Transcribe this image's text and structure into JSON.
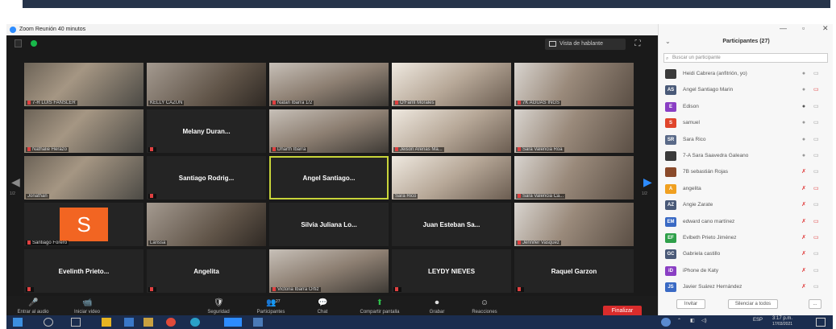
{
  "window": {
    "title": "Zoom Reunión 40 minutos"
  },
  "header": {
    "view_label": "Vista de hablante",
    "fullscreen_icon": "fullscreen-icon"
  },
  "nav": {
    "left_arrow": "◀",
    "right_arrow": "▶",
    "left_page": "1/2",
    "right_page": "1/2"
  },
  "tiles": [
    {
      "label": "7-R LUIS FANSLER",
      "kind": "video",
      "muted": true
    },
    {
      "label": "KELLY CAZUN",
      "kind": "video",
      "muted": false
    },
    {
      "label": "Natan Ibarra 1/2",
      "kind": "video",
      "muted": true
    },
    {
      "label": "O'Farril Morales",
      "kind": "video",
      "muted": true
    },
    {
      "label": "7K AGUAS INGS",
      "kind": "video",
      "muted": true
    },
    {
      "label": "Nathalie Herazo",
      "kind": "video",
      "muted": true
    },
    {
      "label": "Melany Duran...",
      "kind": "name",
      "muted": true
    },
    {
      "label": "Dharth Ibarra",
      "kind": "video",
      "muted": true
    },
    {
      "label": "Jeison Arenas Ma...",
      "kind": "video",
      "muted": true
    },
    {
      "label": "Sara Valencia Roa",
      "kind": "video",
      "muted": true
    },
    {
      "label": "Jonathan",
      "kind": "video",
      "muted": false
    },
    {
      "label": "Santiago Rodrig...",
      "kind": "name",
      "muted": true
    },
    {
      "label": "Angel Santiago...",
      "kind": "name",
      "muted": false,
      "active": true
    },
    {
      "label": "Sara Rico",
      "kind": "video",
      "muted": false
    },
    {
      "label": "Sara Valencia Ca...",
      "kind": "video",
      "muted": true
    },
    {
      "label": "Santiago Forero",
      "kind": "avatar",
      "avatar_letter": "S",
      "muted": true
    },
    {
      "label": "Larissa",
      "kind": "video",
      "muted": false
    },
    {
      "label": "Silvia Juliana Lo...",
      "kind": "name",
      "muted": false
    },
    {
      "label": "Juan Esteban Sa...",
      "kind": "name",
      "muted": false
    },
    {
      "label": "Jennifer Vasquez",
      "kind": "video",
      "muted": true
    },
    {
      "label": "Evelinth Prieto...",
      "kind": "name",
      "muted": true
    },
    {
      "label": "Angelita",
      "kind": "name",
      "muted": true
    },
    {
      "label": "Victoria Ibarra Ortiz",
      "kind": "video",
      "muted": true
    },
    {
      "label": "LEYDY NIEVES",
      "kind": "name",
      "muted": true
    },
    {
      "label": "Raquel Garzon",
      "kind": "name",
      "muted": true
    }
  ],
  "toolbar": {
    "items": [
      {
        "icon": "microphone-icon",
        "glyph": "🎤",
        "label": "Entrar al audio"
      },
      {
        "icon": "video-camera-icon",
        "glyph": "📹",
        "label": "Iniciar video"
      },
      {
        "icon": "security-icon",
        "glyph": "🛡",
        "label": "Seguridad"
      },
      {
        "icon": "participants-icon",
        "glyph": "👥",
        "label": "Participantes",
        "count": "27"
      },
      {
        "icon": "chat-icon",
        "glyph": "💬",
        "label": "Chat"
      },
      {
        "icon": "share-screen-icon",
        "glyph": "⬆",
        "label": "Compartir pantalla"
      },
      {
        "icon": "record-icon",
        "glyph": "⏺",
        "label": "Grabar"
      },
      {
        "icon": "reactions-icon",
        "glyph": "☺",
        "label": "Reacciones"
      }
    ],
    "end_label": "Finalizar"
  },
  "panel": {
    "title": "Participantes (27)",
    "search_placeholder": "Buscar un participante",
    "participants": [
      {
        "initials": "",
        "color": "#3a3a3a",
        "name": "Heidi Cabrera (anfitrión, yo)",
        "mic": "on",
        "cam": "off"
      },
      {
        "initials": "AS",
        "color": "#4a5a78",
        "name": "Angel Santiago Marin",
        "mic": "on",
        "cam": "muted"
      },
      {
        "initials": "E",
        "color": "#8a3fc4",
        "name": "Edison",
        "mic": "active",
        "cam": "off"
      },
      {
        "initials": "S",
        "color": "#e0452b",
        "name": "samuel",
        "mic": "on",
        "cam": "off"
      },
      {
        "initials": "SR",
        "color": "#5a6a88",
        "name": "Sara Rico",
        "mic": "on",
        "cam": "off"
      },
      {
        "initials": "",
        "color": "#3a3a3a",
        "name": "7-A Sara Saavedra Galeano",
        "mic": "on",
        "cam": "off"
      },
      {
        "initials": "",
        "color": "#8a4a2a",
        "name": "7B sebastián Rojas",
        "mic": "muted",
        "cam": "off"
      },
      {
        "initials": "A",
        "color": "#f0a020",
        "name": "angelita",
        "mic": "muted",
        "cam": "muted"
      },
      {
        "initials": "AZ",
        "color": "#4a5a78",
        "name": "Angie Zarate",
        "mic": "muted",
        "cam": "off"
      },
      {
        "initials": "EM",
        "color": "#3a6ac4",
        "name": "edward cano martínez",
        "mic": "muted",
        "cam": "muted"
      },
      {
        "initials": "EF",
        "color": "#2fa04a",
        "name": "Evibeth Prieto Jiménez",
        "mic": "muted",
        "cam": "muted"
      },
      {
        "initials": "GC",
        "color": "#4a5a78",
        "name": "Gabriela castillo",
        "mic": "muted",
        "cam": "off"
      },
      {
        "initials": "iD",
        "color": "#8a3fc4",
        "name": "iPhone de Katy",
        "mic": "muted",
        "cam": "off"
      },
      {
        "initials": "JS",
        "color": "#3a6ac4",
        "name": "Javier Suárez Hernández",
        "mic": "muted",
        "cam": "off"
      }
    ],
    "footer_invite": "Invitar",
    "footer_mute_all": "Silenciar a todos",
    "footer_more": "..."
  },
  "taskbar": {
    "clock_time": "3:17 p.m.",
    "clock_date": "17/03/2021",
    "lang": "ESP"
  },
  "colors": {
    "zoom_blue": "#2d8cff",
    "end_red": "#d92c2c",
    "active_border": "#c8d43a",
    "taskbar": "#1b2d4f"
  }
}
